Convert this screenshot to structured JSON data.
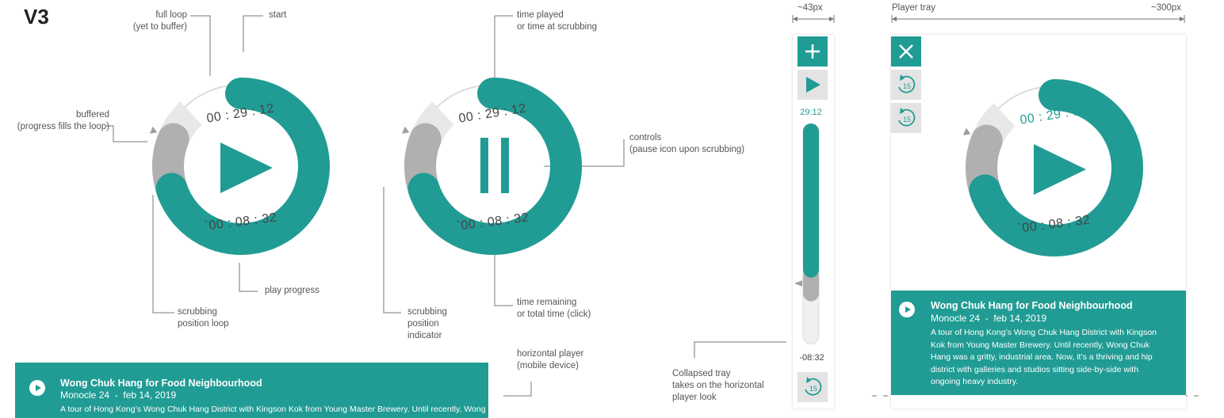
{
  "version_label": "V3",
  "annotations": {
    "full_loop": "full loop",
    "full_loop_sub": "(yet to buffer)",
    "start": "start",
    "buffered": "buffered",
    "buffered_sub": "(progress fills the loop)",
    "play_progress": "play progress",
    "scrubbing_loop": "scrubbing",
    "scrubbing_loop_sub": "position loop",
    "time_played": "time played",
    "time_played_sub": "or time at scrubbing",
    "controls": "controls",
    "controls_sub": "(pause icon upon scrubbing)",
    "scrubbing_indicator_1": "scrubbing",
    "scrubbing_indicator_2": "position",
    "scrubbing_indicator_3": "indicator",
    "time_remaining": "time remaining",
    "time_remaining_sub": "or total time (click)",
    "horizontal_player": "horizontal player",
    "horizontal_player_sub": "(mobile device)",
    "collapsed_tray_1": "Collapsed tray",
    "collapsed_tray_2": "takes on the horizontal",
    "collapsed_tray_3": "player look",
    "width_43": "~43px",
    "player_tray": "Player tray",
    "width_300": "~300px"
  },
  "player": {
    "time_played": "00 : 29 : 12",
    "time_remaining": "`00 : 08 : 32",
    "progress_fraction": 0.7,
    "buffered_fraction": 0.88
  },
  "collapsed_tray": {
    "time_played": "29:12",
    "time_remaining": "-08:32",
    "skip_back_seconds": "15"
  },
  "tray": {
    "skip_back_seconds": "15",
    "skip_forward_seconds": "15"
  },
  "episode": {
    "title": "Wong Chuk Hang for Food Neighbourhood",
    "show": "Monocle 24",
    "separator": "-",
    "date": "feb 14, 2019",
    "description": "A tour of Hong Kong’s Wong Chuk Hang District with Kingson Kok from Young Master Brewery. Until recently, Wong Chuk Hang was a gritty, industrial area. Now, it’s a thriving and hip district with galleries and studios sitting side-by-side with ongoing heavy industry."
  },
  "colors": {
    "teal": "#209c94",
    "buffer_grey": "#e8e8e8",
    "scrub_grey": "#b0b0b0",
    "text_grey": "#555555"
  }
}
